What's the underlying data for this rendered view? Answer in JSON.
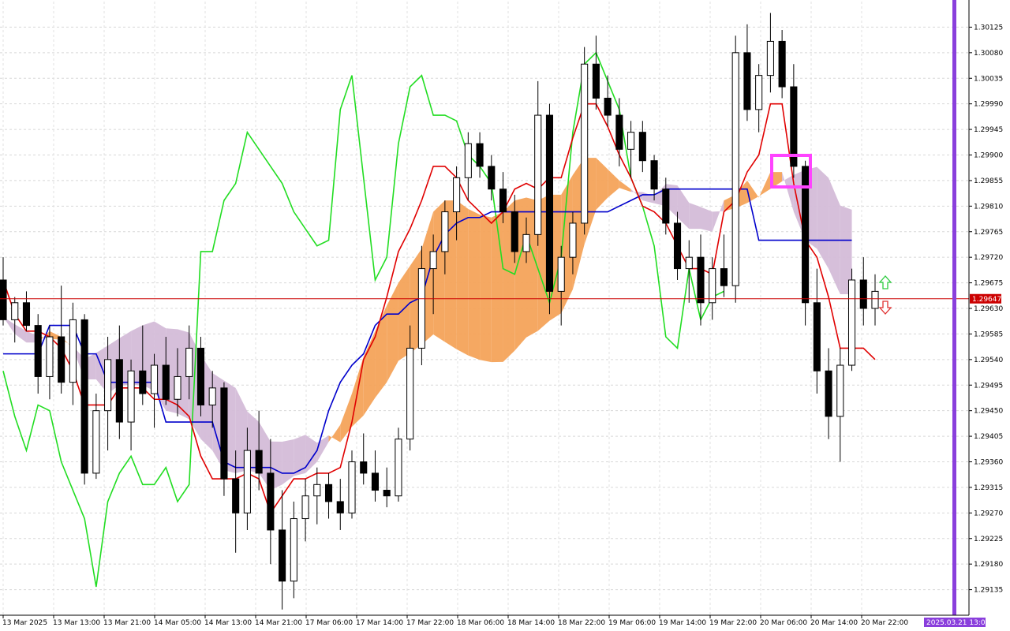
{
  "chart_data": {
    "type": "candlestick",
    "symbol_context": "Ichimoku Kinko Hyo overlay",
    "y_axis": {
      "min": 1.2909,
      "max": 1.3017,
      "tick_labels": [
        "1.30125",
        "1.30080",
        "1.30035",
        "1.29990",
        "1.29945",
        "1.29900",
        "1.29855",
        "1.29810",
        "1.29765",
        "1.29720",
        "1.29675",
        "1.29630",
        "1.29585",
        "1.29540",
        "1.29495",
        "1.29450",
        "1.29405",
        "1.29360",
        "1.29315",
        "1.29270",
        "1.29225",
        "1.29180",
        "1.29135"
      ]
    },
    "x_axis": {
      "tick_labels": [
        "13 Mar 2025",
        "13 Mar 13:00",
        "13 Mar 21:00",
        "14 Mar 05:00",
        "14 Mar 13:00",
        "14 Mar 21:00",
        "17 Mar 06:00",
        "17 Mar 14:00",
        "17 Mar 22:00",
        "18 Mar 06:00",
        "18 Mar 14:00",
        "18 Mar 22:00",
        "19 Mar 06:00",
        "19 Mar 14:00",
        "19 Mar 22:00",
        "20 Mar 06:00",
        "20 Mar 14:00",
        "20 Mar 22:00"
      ]
    },
    "current_price": "1.29647",
    "current_price_value": 1.29647,
    "time_marker": "2025.03.21 13:00",
    "grid": true,
    "colors": {
      "bull_candle": "#ffffff",
      "bear_candle": "#000000",
      "candle_outline": "#000000",
      "tenkan": "#e00000",
      "kijun": "#0000cc",
      "chikou": "#22dd22",
      "kumo_bull": "#f4a35a",
      "kumo_bear": "#d4bcd8",
      "highlight_box": "#ff44ff",
      "current_price_line": "#cc0000",
      "time_marker_line": "#8a3fdc",
      "arrow_up": "#2ecc40",
      "arrow_down": "#e03030"
    },
    "candles": [
      {
        "o": 1.2968,
        "h": 1.2972,
        "l": 1.296,
        "c": 1.2961
      },
      {
        "o": 1.2961,
        "h": 1.2965,
        "l": 1.2957,
        "c": 1.2964
      },
      {
        "o": 1.2964,
        "h": 1.2966,
        "l": 1.2959,
        "c": 1.296
      },
      {
        "o": 1.296,
        "h": 1.2962,
        "l": 1.2948,
        "c": 1.2951
      },
      {
        "o": 1.2951,
        "h": 1.296,
        "l": 1.2947,
        "c": 1.2958
      },
      {
        "o": 1.2958,
        "h": 1.2967,
        "l": 1.2948,
        "c": 1.295
      },
      {
        "o": 1.295,
        "h": 1.2964,
        "l": 1.2946,
        "c": 1.2961
      },
      {
        "o": 1.2961,
        "h": 1.2962,
        "l": 1.2932,
        "c": 1.2934
      },
      {
        "o": 1.2934,
        "h": 1.2948,
        "l": 1.2933,
        "c": 1.2945
      },
      {
        "o": 1.2945,
        "h": 1.2958,
        "l": 1.2938,
        "c": 1.2954
      },
      {
        "o": 1.2954,
        "h": 1.296,
        "l": 1.294,
        "c": 1.2943
      },
      {
        "o": 1.2943,
        "h": 1.2954,
        "l": 1.2938,
        "c": 1.2952
      },
      {
        "o": 1.2952,
        "h": 1.296,
        "l": 1.2946,
        "c": 1.2948
      },
      {
        "o": 1.2948,
        "h": 1.2955,
        "l": 1.2942,
        "c": 1.2953
      },
      {
        "o": 1.2953,
        "h": 1.2958,
        "l": 1.2946,
        "c": 1.2947
      },
      {
        "o": 1.2947,
        "h": 1.2956,
        "l": 1.2944,
        "c": 1.2951
      },
      {
        "o": 1.2951,
        "h": 1.296,
        "l": 1.2947,
        "c": 1.2956
      },
      {
        "o": 1.2956,
        "h": 1.2958,
        "l": 1.2944,
        "c": 1.2946
      },
      {
        "o": 1.2946,
        "h": 1.2952,
        "l": 1.2942,
        "c": 1.2949
      },
      {
        "o": 1.2949,
        "h": 1.295,
        "l": 1.293,
        "c": 1.2933
      },
      {
        "o": 1.2933,
        "h": 1.2938,
        "l": 1.292,
        "c": 1.2927
      },
      {
        "o": 1.2927,
        "h": 1.2942,
        "l": 1.2924,
        "c": 1.2938
      },
      {
        "o": 1.2938,
        "h": 1.2945,
        "l": 1.2931,
        "c": 1.2934
      },
      {
        "o": 1.2934,
        "h": 1.294,
        "l": 1.2918,
        "c": 1.2924
      },
      {
        "o": 1.2924,
        "h": 1.2931,
        "l": 1.291,
        "c": 1.2915
      },
      {
        "o": 1.2915,
        "h": 1.2929,
        "l": 1.2912,
        "c": 1.2926
      },
      {
        "o": 1.2926,
        "h": 1.2933,
        "l": 1.2922,
        "c": 1.293
      },
      {
        "o": 1.293,
        "h": 1.2935,
        "l": 1.2925,
        "c": 1.2932
      },
      {
        "o": 1.2932,
        "h": 1.2934,
        "l": 1.2926,
        "c": 1.2929
      },
      {
        "o": 1.2929,
        "h": 1.2933,
        "l": 1.2924,
        "c": 1.2927
      },
      {
        "o": 1.2927,
        "h": 1.2938,
        "l": 1.2926,
        "c": 1.2936
      },
      {
        "o": 1.2936,
        "h": 1.2941,
        "l": 1.2932,
        "c": 1.2934
      },
      {
        "o": 1.2934,
        "h": 1.2938,
        "l": 1.2929,
        "c": 1.2931
      },
      {
        "o": 1.2931,
        "h": 1.2935,
        "l": 1.2928,
        "c": 1.293
      },
      {
        "o": 1.293,
        "h": 1.2942,
        "l": 1.2929,
        "c": 1.294
      },
      {
        "o": 1.294,
        "h": 1.296,
        "l": 1.2938,
        "c": 1.2956
      },
      {
        "o": 1.2956,
        "h": 1.2974,
        "l": 1.2953,
        "c": 1.297
      },
      {
        "o": 1.297,
        "h": 1.2976,
        "l": 1.2962,
        "c": 1.2973
      },
      {
        "o": 1.2973,
        "h": 1.2982,
        "l": 1.2969,
        "c": 1.298
      },
      {
        "o": 1.298,
        "h": 1.2988,
        "l": 1.2975,
        "c": 1.2986
      },
      {
        "o": 1.2986,
        "h": 1.2994,
        "l": 1.2982,
        "c": 1.2992
      },
      {
        "o": 1.2992,
        "h": 1.2994,
        "l": 1.2986,
        "c": 1.2988
      },
      {
        "o": 1.2988,
        "h": 1.299,
        "l": 1.2982,
        "c": 1.2984
      },
      {
        "o": 1.2984,
        "h": 1.2987,
        "l": 1.2978,
        "c": 1.298
      },
      {
        "o": 1.298,
        "h": 1.2983,
        "l": 1.2971,
        "c": 1.2973
      },
      {
        "o": 1.2973,
        "h": 1.2979,
        "l": 1.2971,
        "c": 1.2976
      },
      {
        "o": 1.2976,
        "h": 1.3003,
        "l": 1.2974,
        "c": 1.2997
      },
      {
        "o": 1.2997,
        "h": 1.2999,
        "l": 1.2962,
        "c": 1.2966
      },
      {
        "o": 1.2966,
        "h": 1.2974,
        "l": 1.296,
        "c": 1.2972
      },
      {
        "o": 1.2972,
        "h": 1.298,
        "l": 1.2969,
        "c": 1.2978
      },
      {
        "o": 1.2978,
        "h": 1.3009,
        "l": 1.2976,
        "c": 1.3006
      },
      {
        "o": 1.3006,
        "h": 1.3011,
        "l": 1.2998,
        "c": 1.3
      },
      {
        "o": 1.3,
        "h": 1.3004,
        "l": 1.2995,
        "c": 1.2997
      },
      {
        "o": 1.2997,
        "h": 1.3,
        "l": 1.2988,
        "c": 1.2991
      },
      {
        "o": 1.2991,
        "h": 1.2996,
        "l": 1.2986,
        "c": 1.2994
      },
      {
        "o": 1.2994,
        "h": 1.2996,
        "l": 1.2987,
        "c": 1.2989
      },
      {
        "o": 1.2989,
        "h": 1.299,
        "l": 1.2982,
        "c": 1.2984
      },
      {
        "o": 1.2984,
        "h": 1.2986,
        "l": 1.2976,
        "c": 1.2978
      },
      {
        "o": 1.2978,
        "h": 1.298,
        "l": 1.2968,
        "c": 1.297
      },
      {
        "o": 1.297,
        "h": 1.2975,
        "l": 1.2964,
        "c": 1.2972
      },
      {
        "o": 1.2972,
        "h": 1.2976,
        "l": 1.296,
        "c": 1.2964
      },
      {
        "o": 1.2964,
        "h": 1.2972,
        "l": 1.2961,
        "c": 1.297
      },
      {
        "o": 1.297,
        "h": 1.2976,
        "l": 1.2965,
        "c": 1.2967
      },
      {
        "o": 1.2967,
        "h": 1.3011,
        "l": 1.2964,
        "c": 1.3008
      },
      {
        "o": 1.3008,
        "h": 1.3013,
        "l": 1.2996,
        "c": 1.2998
      },
      {
        "o": 1.2998,
        "h": 1.3006,
        "l": 1.2994,
        "c": 1.3004
      },
      {
        "o": 1.3004,
        "h": 1.3015,
        "l": 1.3001,
        "c": 1.301
      },
      {
        "o": 1.301,
        "h": 1.3012,
        "l": 1.3,
        "c": 1.3002
      },
      {
        "o": 1.3002,
        "h": 1.3006,
        "l": 1.2986,
        "c": 1.2988
      },
      {
        "o": 1.2988,
        "h": 1.2989,
        "l": 1.296,
        "c": 1.2964
      },
      {
        "o": 1.2964,
        "h": 1.297,
        "l": 1.2948,
        "c": 1.2952
      },
      {
        "o": 1.2952,
        "h": 1.2956,
        "l": 1.294,
        "c": 1.2944
      },
      {
        "o": 1.2944,
        "h": 1.2956,
        "l": 1.2936,
        "c": 1.2953
      },
      {
        "o": 1.2953,
        "h": 1.297,
        "l": 1.2952,
        "c": 1.2968
      },
      {
        "o": 1.2968,
        "h": 1.2972,
        "l": 1.296,
        "c": 1.2963
      },
      {
        "o": 1.2963,
        "h": 1.2969,
        "l": 1.296,
        "c": 1.2966
      }
    ],
    "tenkan": [
      1.2968,
      1.2962,
      1.2959,
      1.2959,
      1.2958,
      1.2956,
      1.2952,
      1.2946,
      1.2946,
      1.2946,
      1.2949,
      1.2949,
      1.2949,
      1.2947,
      1.2947,
      1.2946,
      1.2944,
      1.2937,
      1.2933,
      1.2933,
      1.2933,
      1.2934,
      1.2933,
      1.2927,
      1.293,
      1.2933,
      1.2933,
      1.2934,
      1.2934,
      1.2935,
      1.2943,
      1.2954,
      1.2958,
      1.2965,
      1.2973,
      1.2977,
      1.2982,
      1.2988,
      1.2988,
      1.2986,
      1.2982,
      1.298,
      1.2978,
      1.298,
      1.2984,
      1.2985,
      1.2984,
      1.2986,
      1.2986,
      1.2993,
      1.2999,
      1.2999,
      1.2995,
      1.299,
      1.2986,
      1.2981,
      1.298,
      1.2978,
      1.2974,
      1.297,
      1.297,
      1.2969,
      1.298,
      1.2982,
      1.2987,
      1.299,
      1.2999,
      1.2999,
      1.2985,
      1.2975,
      1.2972,
      1.2965,
      1.2956,
      1.2956,
      1.2956,
      1.2954
    ],
    "kijun": [
      1.2955,
      1.2955,
      1.2955,
      1.2955,
      1.296,
      1.296,
      1.296,
      1.2955,
      1.2955,
      1.295,
      1.295,
      1.295,
      1.295,
      1.295,
      1.2943,
      1.2943,
      1.2943,
      1.2943,
      1.2943,
      1.2936,
      1.2935,
      1.2935,
      1.2935,
      1.2935,
      1.2934,
      1.2934,
      1.2935,
      1.2938,
      1.2945,
      1.295,
      1.2953,
      1.2955,
      1.296,
      1.2962,
      1.2962,
      1.2964,
      1.2965,
      1.2972,
      1.2976,
      1.2978,
      1.2979,
      1.2979,
      1.298,
      1.298,
      1.298,
      1.298,
      1.298,
      1.298,
      1.298,
      1.298,
      1.298,
      1.298,
      1.298,
      1.2981,
      1.2982,
      1.2983,
      1.2983,
      1.2984,
      1.2984,
      1.2984,
      1.2984,
      1.2984,
      1.2984,
      1.2984,
      1.2984,
      1.2975,
      1.2975,
      1.2975,
      1.2975,
      1.2975,
      1.2975,
      1.2975,
      1.2975,
      1.2975
    ],
    "chikou": [
      1.2952,
      1.2944,
      1.2938,
      1.2946,
      1.2945,
      1.2936,
      1.2931,
      1.2926,
      1.2914,
      1.2929,
      1.2934,
      1.2937,
      1.2932,
      1.2932,
      1.2935,
      1.2929,
      1.2932,
      1.2973,
      1.2973,
      1.2982,
      1.2985,
      1.2994,
      1.2991,
      1.2988,
      1.2985,
      1.298,
      1.2977,
      1.2974,
      1.2975,
      1.2998,
      1.3004,
      1.2986,
      1.2968,
      1.2972,
      1.2992,
      1.3002,
      1.3004,
      1.2997,
      1.2997,
      1.2996,
      1.299,
      1.2988,
      1.2985,
      1.297,
      1.2969,
      1.2976,
      1.297,
      1.2964,
      1.2972,
      1.2994,
      1.3006,
      1.3008,
      1.3003,
      1.2998,
      1.2986,
      1.2981,
      1.2974,
      1.2958,
      1.2956,
      1.297,
      1.2961,
      1.2965,
      1.2966
    ]
  },
  "overlay": {
    "price_tag": "1.29647",
    "time_tag": "2025.03.21 13:00"
  }
}
